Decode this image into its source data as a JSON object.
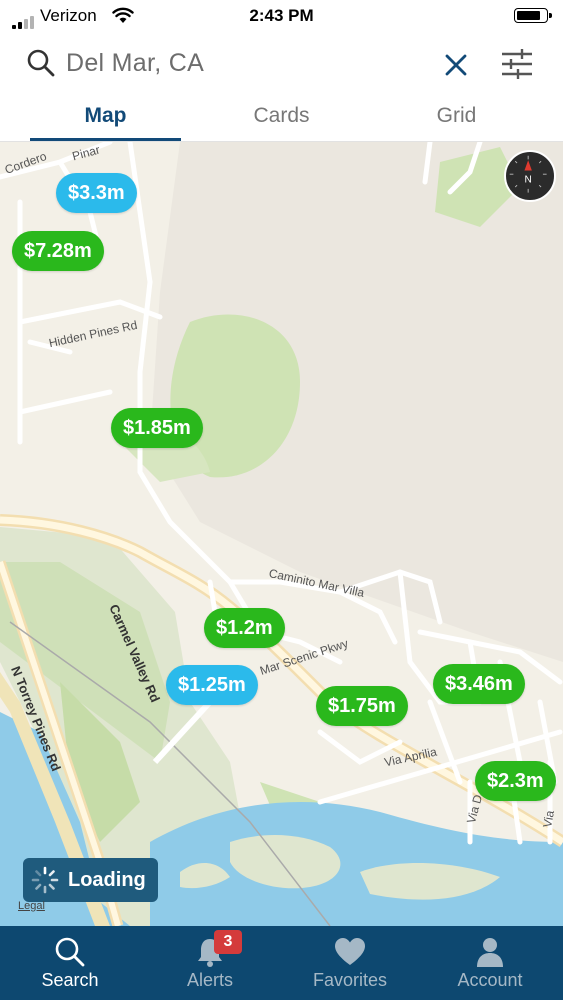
{
  "status_bar": {
    "carrier": "Verizon",
    "time": "2:43 PM",
    "battery_level": 0.85
  },
  "search": {
    "query": "Del Mar, CA",
    "icon": "search-icon",
    "clear_icon": "close-icon",
    "filter_icon": "filter-sliders-icon"
  },
  "tabs": [
    {
      "label": "Map",
      "active": true
    },
    {
      "label": "Cards",
      "active": false
    },
    {
      "label": "Grid",
      "active": false
    }
  ],
  "map": {
    "road_labels": [
      "Cordero",
      "Pinar",
      "Hidden Pines Rd",
      "Caminito Mar Villa",
      "Carmel Valley Rd",
      "Mar Scenic Pkwy",
      "N Torrey Pines Rd",
      "Via Aprilia",
      "Via D",
      "Via"
    ],
    "price_pins": [
      {
        "price": "$3.3m",
        "color": "blue"
      },
      {
        "price": "$7.28m",
        "color": "green"
      },
      {
        "price": "$1.85m",
        "color": "green"
      },
      {
        "price": "$1.2m",
        "color": "green"
      },
      {
        "price": "$1.25m",
        "color": "blue"
      },
      {
        "price": "$1.75m",
        "color": "green"
      },
      {
        "price": "$3.46m",
        "color": "green"
      },
      {
        "price": "$2.3m",
        "color": "green"
      }
    ],
    "loading_label": "Loading",
    "legal_label": "Legal",
    "compass_label": "N"
  },
  "bottom_nav": [
    {
      "label": "Search",
      "icon": "search-icon",
      "active": true
    },
    {
      "label": "Alerts",
      "icon": "bell-icon",
      "active": false,
      "badge": "3"
    },
    {
      "label": "Favorites",
      "icon": "heart-icon",
      "active": false
    },
    {
      "label": "Account",
      "icon": "person-icon",
      "active": false
    }
  ],
  "colors": {
    "brand_navy": "#0d4870",
    "tab_active": "#124a78",
    "pin_green": "#2ab81c",
    "pin_blue": "#2bbaeb",
    "badge_red": "#d43b3b"
  }
}
